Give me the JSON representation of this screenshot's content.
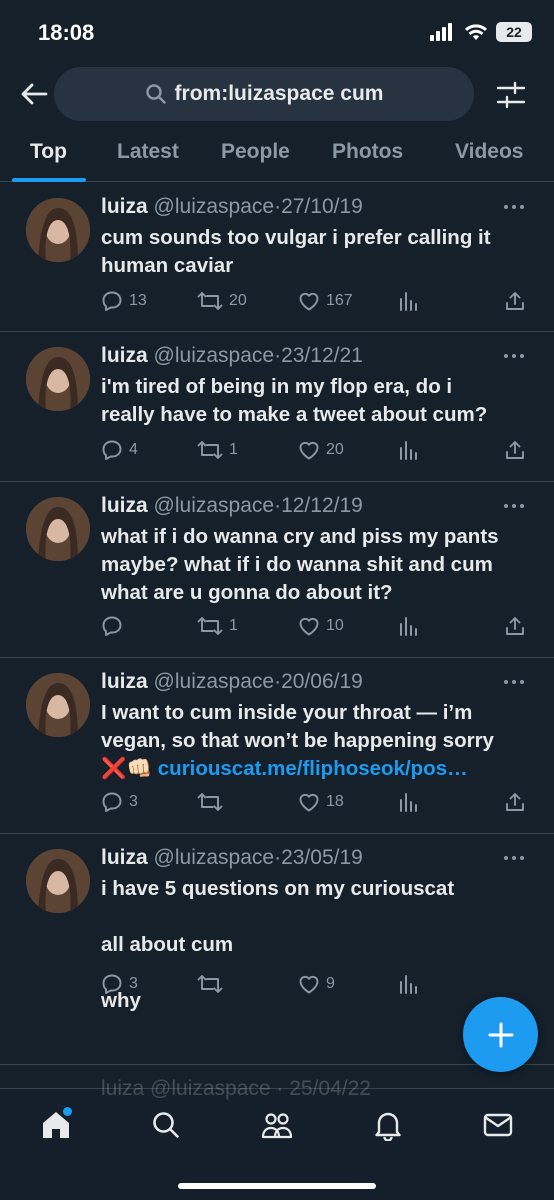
{
  "status": {
    "time": "18:08",
    "battery": "22"
  },
  "search": {
    "query": "from:luizaspace cum"
  },
  "tabs": [
    "Top",
    "Latest",
    "People",
    "Photos",
    "Videos"
  ],
  "tweets": [
    {
      "name": "luiza",
      "handle": "@luizaspace",
      "sep": "·",
      "date": "27/10/19",
      "text": [
        "cum sounds too vulgar i prefer calling it",
        "human caviar"
      ],
      "replies": "13",
      "retweets": "20",
      "likes": "167"
    },
    {
      "name": "luiza",
      "handle": "@luizaspace",
      "sep": "·",
      "date": "23/12/21",
      "text": [
        "i'm tired of being in my flop era, do i",
        "really have to make a tweet about cum?"
      ],
      "replies": "4",
      "retweets": "1",
      "likes": "20"
    },
    {
      "name": "luiza",
      "handle": "@luizaspace",
      "sep": "·",
      "date": "12/12/19",
      "text": [
        "what if i do wanna cry and piss my pants",
        "maybe? what if i do wanna shit and cum",
        "what are u gonna do about it?"
      ],
      "replies": "",
      "retweets": "1",
      "likes": "10"
    },
    {
      "name": "luiza",
      "handle": "@luizaspace",
      "sep": "·",
      "date": "20/06/19",
      "text": [
        "I want to cum inside your throat — i’m",
        "vegan, so that won’t be happening sorry"
      ],
      "emoji": "❌👊🏻",
      "link": "curiouscat.me/fliphoseok/pos…",
      "replies": "3",
      "retweets": "",
      "likes": "18"
    },
    {
      "name": "luiza",
      "handle": "@luizaspace",
      "sep": "·",
      "date": "23/05/19",
      "text": [
        "i have 5 questions on my curiouscat",
        "",
        "all about cum",
        "",
        "why"
      ],
      "replies": "3",
      "retweets": "",
      "likes": "9"
    }
  ],
  "peek": {
    "text": "luiza @luizaspace · 25/04/22"
  },
  "colors": {
    "background": "#15202b",
    "accent": "#1d9bf0",
    "muted": "#8b98a5",
    "text": "#e7e9ea"
  },
  "nav": [
    "home-icon",
    "search-icon",
    "communities-icon",
    "bell-icon",
    "mail-icon"
  ]
}
